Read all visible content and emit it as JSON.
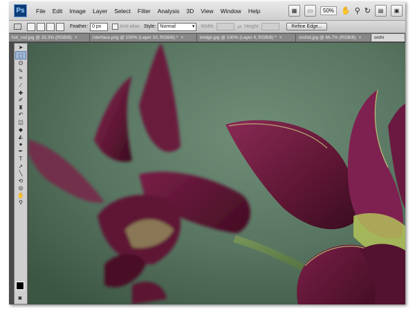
{
  "app": {
    "logo_text": "Ps"
  },
  "menu": [
    "File",
    "Edit",
    "Image",
    "Layer",
    "Select",
    "Filter",
    "Analysis",
    "3D",
    "View",
    "Window",
    "Help"
  ],
  "appbar": {
    "zoom": "50%"
  },
  "options": {
    "feather_label": "Feather:",
    "feather_value": "0 px",
    "antialias_label": "Anti-alias",
    "style_label": "Style:",
    "style_value": "Normal",
    "width_label": "Width:",
    "height_label": "Height:",
    "refine_label": "Refine Edge..."
  },
  "tabs": [
    "hot_rod.jpg @ 33.3% (RGB/8)",
    "interface.png @ 100% (Layer 10, RGB/8) *",
    "bridge.jpg @ 100% (Layer 4, RGB/8) *",
    "orchid.jpg @ 66.7% (RGB/8)",
    "orchi"
  ],
  "tabs_close": "×",
  "colors": {
    "accent": "#0d3c78",
    "petal": "#6e1a3c",
    "background": "#5a7763"
  }
}
